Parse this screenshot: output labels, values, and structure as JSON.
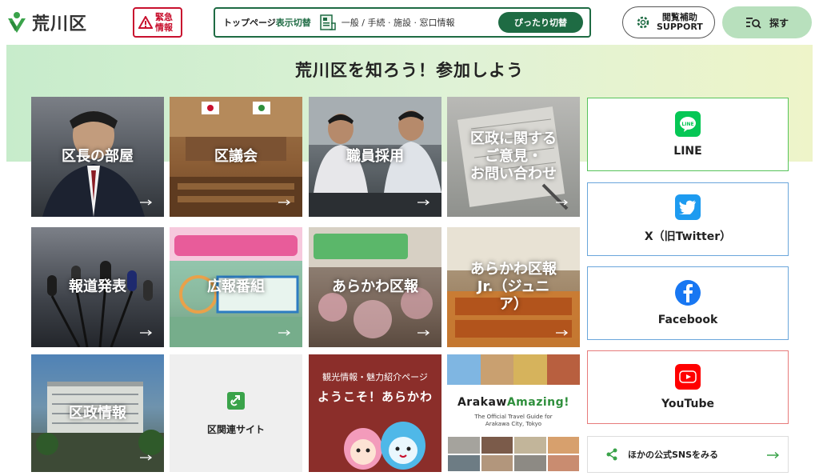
{
  "colors": {
    "brand_green": "#1e6b43",
    "emergency_red": "#c8102e",
    "banner_start": "#c7eccb",
    "banner_end": "#eef4c9",
    "search_bg": "#b8e0bd",
    "line_border": "#56c35a",
    "x_border": "#6aa6db",
    "facebook_border": "#6aa6db",
    "youtube_border": "#e77b7b"
  },
  "header": {
    "logo_text": "荒川区",
    "logo_icon": "arakawa-city-mark-icon",
    "emergency_label": "緊急\n情報",
    "emergency_icon": "warning-icon",
    "switch": {
      "title_prefix": "トップページ",
      "title_highlight": "表示切替",
      "icon": "document-icon",
      "categories": "一般 / 手続 · 施設 · 窓口情報",
      "button_label": "ぴったり切替"
    },
    "support_label": "閲覧補助\nSUPPORT",
    "support_icon": "gear-icon",
    "search_label": "探す",
    "search_icon": "search-list-icon"
  },
  "banner": {
    "title": "荒川区を知ろう！参加しよう"
  },
  "tiles": [
    {
      "label": "区長の部屋"
    },
    {
      "label": "区議会"
    },
    {
      "label": "職員採用"
    },
    {
      "label": "区政に関する\nご意見・\nお問い合わせ"
    },
    {
      "label": "報道発表"
    },
    {
      "label": "広報番組"
    },
    {
      "label": "あらかわ区報"
    },
    {
      "label": "あらかわ区報\nJr.（ジュニ\nア）"
    },
    {
      "label": "区政情報"
    },
    {
      "label": "区関連サイト",
      "icon": "external-link-icon"
    }
  ],
  "welcome": {
    "top_text": "観光情報・魅力紹介ページ",
    "main_text": "ようこそ！あらかわ"
  },
  "amazing": {
    "title_a": "Arakaw",
    "title_b": "Amazing!",
    "subtitle": "The Official Travel Guide for\nArakawa City, Tokyo"
  },
  "sns": [
    {
      "label": "LINE",
      "icon": "line-icon"
    },
    {
      "label": "X（旧Twitter）",
      "icon": "x-twitter-icon"
    },
    {
      "label": "Facebook",
      "icon": "facebook-icon"
    },
    {
      "label": "YouTube",
      "icon": "youtube-icon"
    }
  ],
  "sns_more": {
    "label": "ほかの公式SNSをみる",
    "icon": "share-icon"
  }
}
